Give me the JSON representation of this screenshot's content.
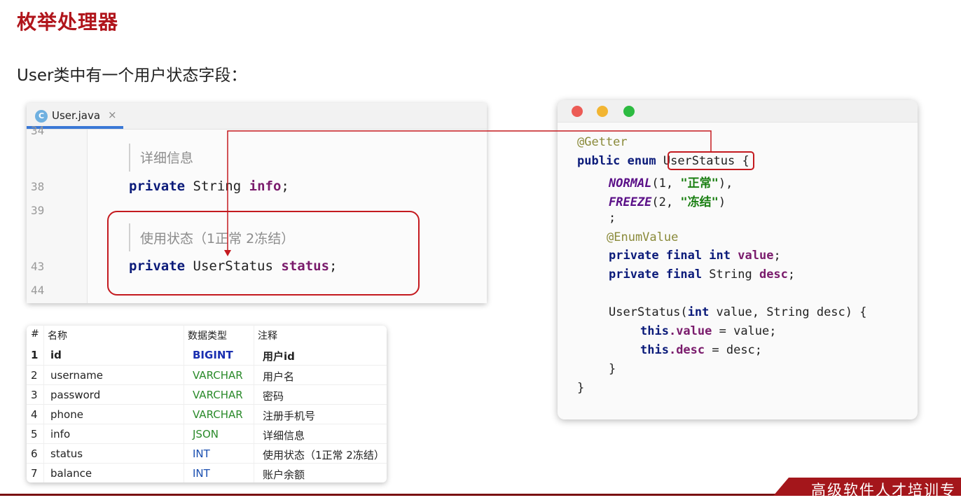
{
  "slide": {
    "title": "枚举处理器",
    "subtitle": "User类中有一个用户状态字段："
  },
  "ide": {
    "tab_icon_letter": "C",
    "tab_label": "User.java",
    "tab_close": "×",
    "line_numbers": [
      "34",
      "38",
      "39",
      "43",
      "44"
    ],
    "doc_info": "详细信息",
    "info_line": {
      "kw": "private",
      "type": "String",
      "field": "info",
      "end": ";"
    },
    "doc_status": "使用状态（1正常 2冻结）",
    "status_line": {
      "kw": "private",
      "type": "UserStatus",
      "field": "status",
      "end": ";"
    }
  },
  "table": {
    "headers": [
      "#",
      "名称",
      "数据类型",
      "注释"
    ],
    "rows": [
      {
        "num": "1",
        "name": "id",
        "type": "BIGINT",
        "comment": "用户id"
      },
      {
        "num": "2",
        "name": "username",
        "type": "VARCHAR",
        "comment": "用户名"
      },
      {
        "num": "3",
        "name": "password",
        "type": "VARCHAR",
        "comment": "密码"
      },
      {
        "num": "4",
        "name": "phone",
        "type": "VARCHAR",
        "comment": "注册手机号"
      },
      {
        "num": "5",
        "name": "info",
        "type": "JSON",
        "comment": "详细信息"
      },
      {
        "num": "6",
        "name": "status",
        "type": "INT",
        "comment": "使用状态（1正常 2冻结）"
      },
      {
        "num": "7",
        "name": "balance",
        "type": "INT",
        "comment": "账户余额"
      }
    ],
    "type_colors": {
      "BIGINT": "#1a2fb0",
      "VARCHAR": "#2a8a2a",
      "JSON": "#2a8a2a",
      "INT": "#1a4fb0"
    }
  },
  "code": {
    "getter": "@Getter",
    "enum_kw": "public enum",
    "enum_name": "UserStatus",
    "open_brace": "{",
    "normal_name": "NORMAL",
    "normal_args_open": "(1, ",
    "normal_str": "\"正常\"",
    "normal_args_close": "),",
    "freeze_name": "FREEZE",
    "freeze_args_open": "(2, ",
    "freeze_str": "\"冻结\"",
    "freeze_args_close": ")",
    "semicolon": ";",
    "enum_value_anno": "@EnumValue",
    "field1_kw": "private final int",
    "field1_name": "value",
    "field1_end": ";",
    "field2_kw": "private final",
    "field2_type": " String ",
    "field2_name": "desc",
    "field2_end": ";",
    "ctor_name": "UserStatus(",
    "ctor_kw": "int",
    "ctor_rest": " value, String desc) {",
    "this1_kw": "this",
    "this1_field": ".value",
    "this1_rest": " = value;",
    "this2_kw": "this",
    "this2_field": ".desc",
    "this2_rest": " = desc;",
    "inner_close": "}",
    "outer_close": "}"
  },
  "footer": {
    "text": "高级软件人才培训专"
  },
  "colors": {
    "title_red": "#b0151b",
    "highlight_red": "#c41a1f",
    "dot_red": "#ec5b55",
    "dot_yellow": "#f2b532",
    "dot_green": "#2dbb41"
  }
}
